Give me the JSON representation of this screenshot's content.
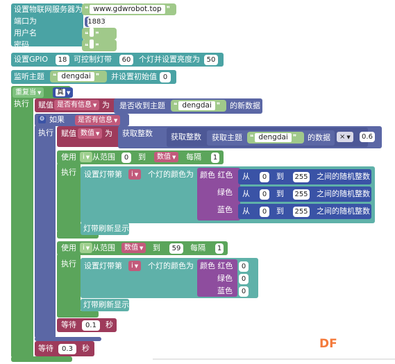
{
  "rows": {
    "server_label": "设置物联网服务器为",
    "server_value": "www.gdwrobot.top",
    "port_label": "端口为",
    "port_value": "1883",
    "user_label": "用户名",
    "pass_label": "密码",
    "gpio_label": "设置GPIO",
    "gpio_value": "18",
    "strip_label": "可控制灯带",
    "strip_count": "60",
    "brightness_label": "个灯并设置亮度为",
    "brightness_value": "50",
    "listen_label": "监听主题",
    "listen_topic": "dengdai",
    "init_label": "并设置初始值",
    "init_value": "0"
  },
  "loop": {
    "repeat_label": "重复当",
    "cond_value": "真",
    "do_label": "执行",
    "assign_label": "赋值",
    "var_has_msg": "是否有信息",
    "as_label": "为",
    "received_label": "是否收到主题",
    "received_topic": "dengdai",
    "new_data_label": "的新数据",
    "if_label": "如果",
    "then_label": "执行",
    "var_data": "数值",
    "get_int_label": "获取整数",
    "get_int2_label": "获取整数",
    "get_topic_label": "获取主题",
    "get_topic_value": "dengdai",
    "data_label": "的数据",
    "op_label": "×",
    "multiplier": "0.6"
  },
  "for1": {
    "use_label": "使用",
    "var": "i",
    "range_label": "从范围",
    "from": "0",
    "to_label": "到",
    "to_var": "数值",
    "step_label": "每隔",
    "step": "1",
    "do_label": "执行",
    "set_label": "设置灯带第",
    "set_var": "i",
    "color_label": "个灯的颜色为",
    "color_label2": "颜色 红色",
    "green_label": "绿色",
    "blue_label": "蓝色",
    "rand_from": "从",
    "rand_lo": "0",
    "rand_to": "到",
    "rand_hi": "255",
    "rand_desc": "之间的随机整数",
    "refresh_label": "灯带刷新显示"
  },
  "for2": {
    "use_label": "使用",
    "var": "i",
    "range_label": "从范围",
    "from_var": "数值",
    "to_label": "到",
    "to": "59",
    "step_label": "每隔",
    "step": "1",
    "do_label": "执行",
    "set_label": "设置灯带第",
    "set_var": "i",
    "color_label": "个灯的颜色为",
    "color_label2": "颜色 红色",
    "red_value": "0",
    "green_label": "绿色",
    "green_value": "0",
    "blue_label": "蓝色",
    "blue_value": "0",
    "refresh_label": "灯带刷新显示"
  },
  "waits": {
    "wait_label": "等待",
    "wait1": "0.1",
    "wait2": "0.3",
    "sec_label": "秒"
  },
  "watermark": "DF",
  "colors": {
    "teal": "#4aa3a4",
    "blue": "#5b67a5",
    "purple": "#8e4d9e",
    "dark_blue": "#3a53a6",
    "green": "#5ba55b",
    "light_teal": "#5fb1a9",
    "maroon": "#9e3b5b",
    "pink": "#a55b80",
    "string_green": "#a0c98a",
    "orange": "#f47a3b"
  }
}
